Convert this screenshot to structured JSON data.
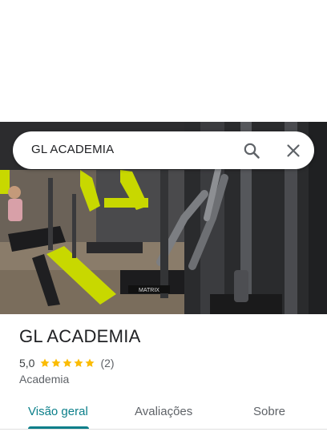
{
  "search": {
    "query": "GL ACADEMIA"
  },
  "hero": {
    "machine_brand": "MATRIX"
  },
  "place": {
    "name": "GL ACADEMIA",
    "rating": "5,0",
    "stars": 5,
    "review_count": "(2)",
    "category": "Academia"
  },
  "tabs": [
    {
      "label": "Visão geral",
      "active": true
    },
    {
      "label": "Avaliações",
      "active": false
    },
    {
      "label": "Sobre",
      "active": false
    }
  ],
  "colors": {
    "accent": "#0b7f8a",
    "star": "#fbbc04",
    "machine_yellow": "#c8d800"
  },
  "icons": [
    "search-icon",
    "close-icon",
    "star-icon"
  ]
}
